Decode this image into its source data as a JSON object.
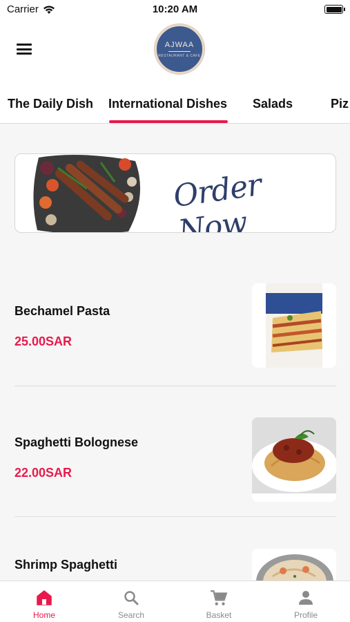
{
  "status_bar": {
    "carrier": "Carrier",
    "time": "10:20 AM"
  },
  "header": {
    "logo_text": "AJWAA",
    "logo_subtext": "RESTAURANT & CAFE"
  },
  "tabs": [
    {
      "label": "The Daily Dish",
      "active": false
    },
    {
      "label": "International Dishes",
      "active": true
    },
    {
      "label": "Salads",
      "active": false
    },
    {
      "label": "Piz",
      "active": false
    }
  ],
  "banner": {
    "text": "Order Now"
  },
  "items": [
    {
      "name": "Bechamel Pasta",
      "price": "25.00SAR"
    },
    {
      "name": "Spaghetti Bolognese",
      "price": "22.00SAR"
    },
    {
      "name": "Shrimp Spaghetti",
      "price": ""
    }
  ],
  "bottom_nav": [
    {
      "label": "Home",
      "icon": "home-icon",
      "active": true
    },
    {
      "label": "Search",
      "icon": "search-icon",
      "active": false
    },
    {
      "label": "Basket",
      "icon": "cart-icon",
      "active": false
    },
    {
      "label": "Profile",
      "icon": "person-icon",
      "active": false
    }
  ],
  "colors": {
    "accent": "#e8194b",
    "logo_bg": "#3d5a8f",
    "inactive": "#8a8a8a"
  }
}
